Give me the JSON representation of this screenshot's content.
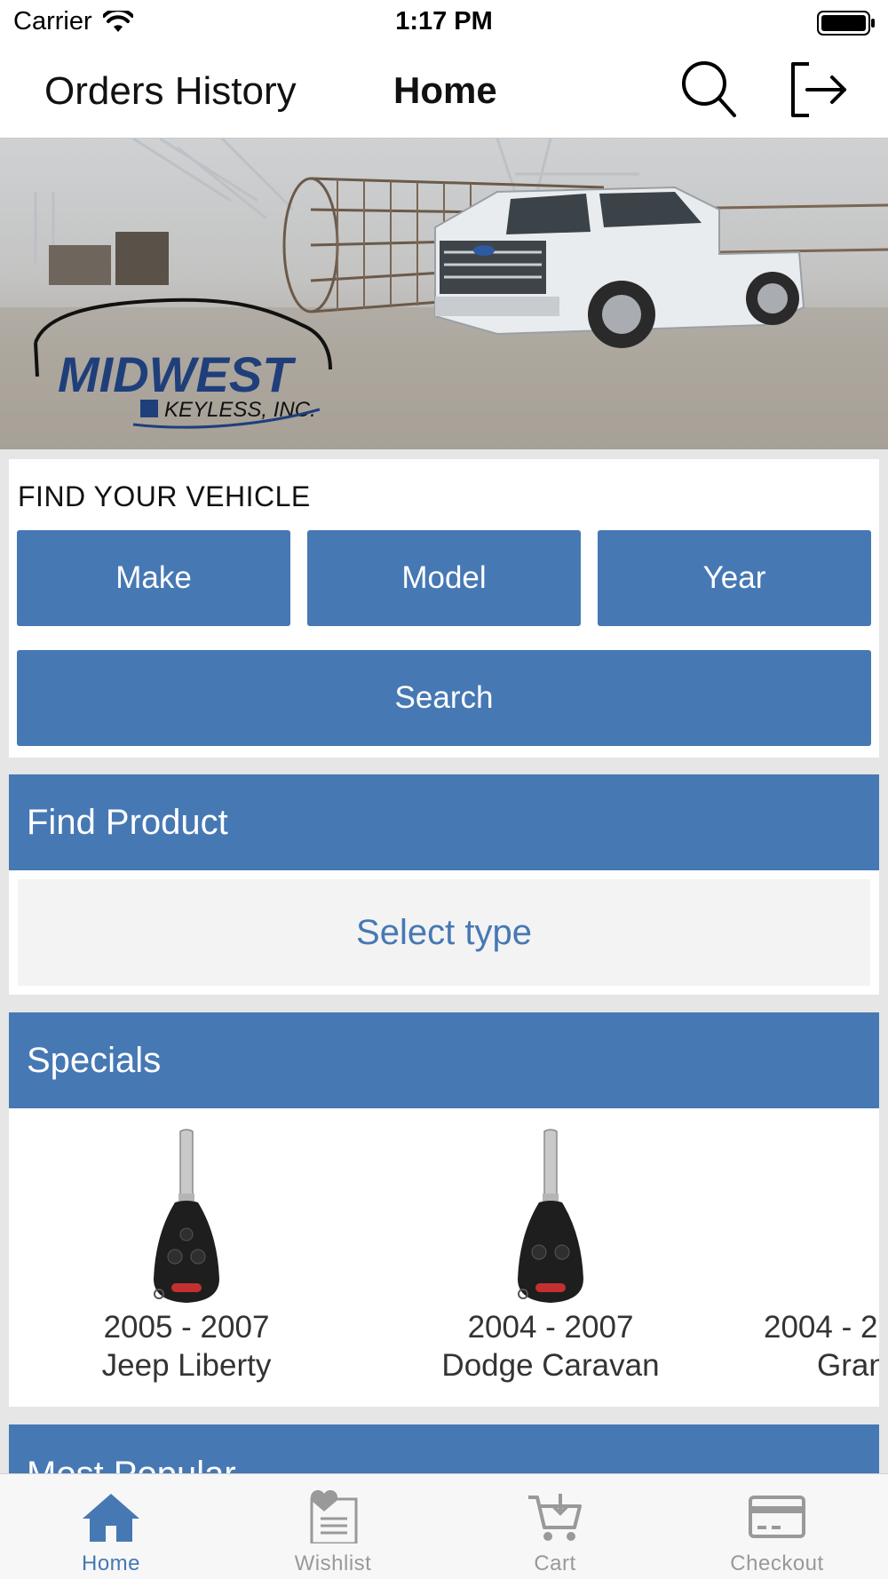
{
  "status_bar": {
    "carrier": "Carrier",
    "time": "1:17 PM"
  },
  "nav": {
    "orders_history": "Orders History",
    "home": "Home"
  },
  "banner": {
    "logo_line1": "MIDWEST",
    "logo_line2": "KEYLESS, INC."
  },
  "find_vehicle": {
    "title": "FIND YOUR VEHICLE",
    "make": "Make",
    "model": "Model",
    "year": "Year",
    "search": "Search"
  },
  "find_product": {
    "header": "Find Product",
    "select_type": "Select type"
  },
  "specials": {
    "header": "Specials",
    "items": [
      {
        "years": "2005 - 2007",
        "name": "Jeep Liberty"
      },
      {
        "years": "2004 - 2007",
        "name": "Dodge Caravan"
      },
      {
        "years": "2004 - 2",
        "name": "Grand"
      }
    ]
  },
  "most_popular": {
    "header": "Most Popular"
  },
  "tabs": [
    {
      "label": "Home",
      "icon": "home-icon",
      "active": true
    },
    {
      "label": "Wishlist",
      "icon": "wishlist-icon",
      "active": false
    },
    {
      "label": "Cart",
      "icon": "cart-icon",
      "active": false
    },
    {
      "label": "Checkout",
      "icon": "credit-card-icon",
      "active": false
    }
  ],
  "colors": {
    "accent": "#4678b4",
    "inactive_tab": "#999999"
  }
}
